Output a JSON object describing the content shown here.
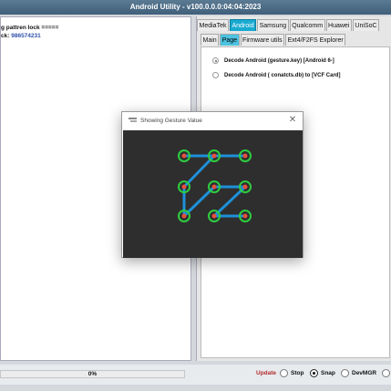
{
  "app": {
    "title": "Android Utility - v100.0.0.0:04:04:2023"
  },
  "log": {
    "line1": "g pattren lock =====",
    "line2_label": "ck:",
    "line2_value": "986574231"
  },
  "tabs_primary": [
    {
      "label": "MediaTek",
      "active": false
    },
    {
      "label": "Android",
      "active": true
    },
    {
      "label": "Samsung",
      "active": false
    },
    {
      "label": "Qualcomm",
      "active": false
    },
    {
      "label": "Huawei",
      "active": false
    },
    {
      "label": "UniSoC",
      "active": false
    }
  ],
  "tabs_secondary": [
    {
      "label": "Main",
      "active": false
    },
    {
      "label": "Page",
      "active": true
    },
    {
      "label": "Firmware utils",
      "active": false
    },
    {
      "label": "Ext4/F2FS Explorer",
      "active": false
    }
  ],
  "options": [
    {
      "label": "Decode Android (gesture.key) [Android 6-]",
      "checked": true
    },
    {
      "label": "Decode Android ( conatcts.db) to [VCF Card]",
      "checked": false
    }
  ],
  "status": {
    "progress": 0,
    "progress_text": "0%",
    "update_label": "Update",
    "stop_label": "Stop",
    "snap_label": "Snap",
    "devmgr_label": "DevMGR",
    "selected": "snap"
  },
  "dialog": {
    "title": "Showing Gesture Value",
    "close_icon": "close-icon",
    "pattern": "986574231",
    "colors": {
      "background": "#2e2e2e",
      "dot_outer": "#2ecc40",
      "dot_inner": "#e8503a",
      "line": "#1e90d8"
    }
  }
}
